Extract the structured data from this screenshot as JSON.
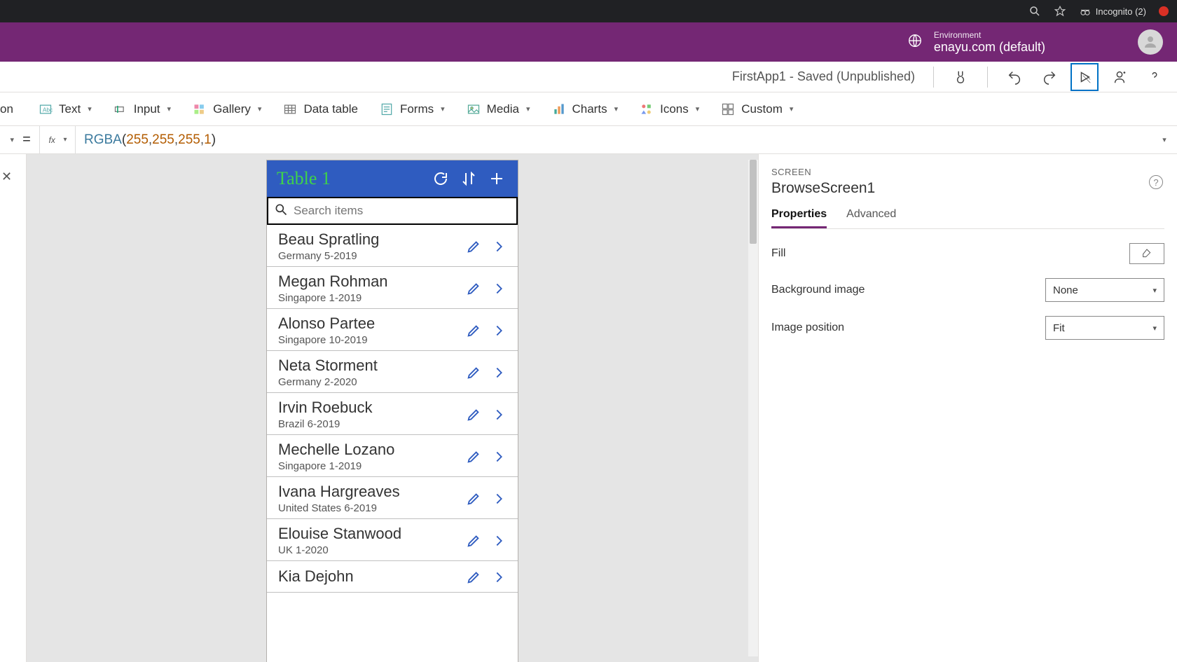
{
  "browser": {
    "incognito_label": "Incognito (2)"
  },
  "environment": {
    "label": "Environment",
    "value": "enayu.com (default)"
  },
  "app": {
    "title": "FirstApp1 - Saved (Unpublished)"
  },
  "ribbon": {
    "partial": "on",
    "text": "Text",
    "input": "Input",
    "gallery": "Gallery",
    "data_table": "Data table",
    "forms": "Forms",
    "media": "Media",
    "charts": "Charts",
    "icons": "Icons",
    "custom": "Custom"
  },
  "formula_bar": {
    "eq": "=",
    "tokens": {
      "fn": "RGBA",
      "open": "(",
      "n1": "255",
      "c1": ", ",
      "n2": "255",
      "c2": ", ",
      "n3": "255",
      "c3": ", ",
      "n4": "1",
      "close": ")"
    }
  },
  "phone": {
    "title": "Table 1",
    "search_placeholder": "Search items",
    "items": [
      {
        "name": "Beau Spratling",
        "sub": "Germany 5-2019"
      },
      {
        "name": "Megan Rohman",
        "sub": "Singapore 1-2019"
      },
      {
        "name": "Alonso Partee",
        "sub": "Singapore 10-2019"
      },
      {
        "name": "Neta Storment",
        "sub": "Germany 2-2020"
      },
      {
        "name": "Irvin Roebuck",
        "sub": "Brazil 6-2019"
      },
      {
        "name": "Mechelle Lozano",
        "sub": "Singapore 1-2019"
      },
      {
        "name": "Ivana Hargreaves",
        "sub": "United States 6-2019"
      },
      {
        "name": "Elouise Stanwood",
        "sub": "UK 1-2020"
      },
      {
        "name": "Kia Dejohn",
        "sub": ""
      }
    ]
  },
  "properties_panel": {
    "screen_label": "SCREEN",
    "screen_name": "BrowseScreen1",
    "tabs": {
      "properties": "Properties",
      "advanced": "Advanced"
    },
    "rows": {
      "fill": "Fill",
      "background_image": "Background image",
      "background_image_value": "None",
      "image_position": "Image position",
      "image_position_value": "Fit"
    }
  }
}
